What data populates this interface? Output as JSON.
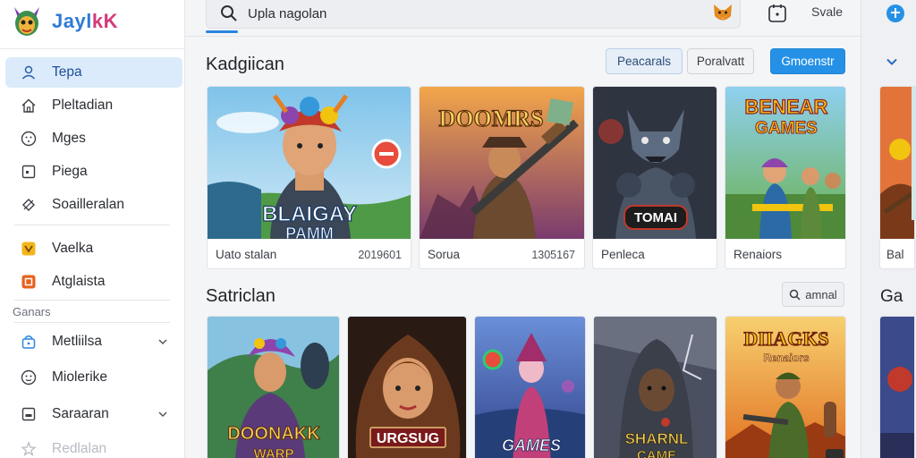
{
  "brand": {
    "name_main": "Jayl",
    "name_accent": "kK"
  },
  "search": {
    "value": "Upla nagolan",
    "placeholder": ""
  },
  "topbar": {
    "save_label": "Svale"
  },
  "sidebar": {
    "items": [
      {
        "label": "Tepa",
        "icon": "user-icon"
      },
      {
        "label": "Pleltadian",
        "icon": "home-icon"
      },
      {
        "label": "Mges",
        "icon": "smiley-icon"
      },
      {
        "label": "Piega",
        "icon": "page-icon"
      },
      {
        "label": "Soailleralan",
        "icon": "tag-icon"
      },
      {
        "label": "Vaelka",
        "icon": "orange-badge-icon"
      },
      {
        "label": "Atglaista",
        "icon": "orange-square-icon"
      }
    ],
    "section_label": "Ganars",
    "sub_items": [
      {
        "label": "Metliilsa",
        "icon": "lock-icon"
      },
      {
        "label": "Miolerike",
        "icon": "smiley-icon"
      },
      {
        "label": "Saraaran",
        "icon": "page-icon"
      },
      {
        "label": "Redlalan",
        "icon": "star-icon"
      }
    ]
  },
  "section1": {
    "title": "Kadgiican",
    "tabs": [
      "Peacarals",
      "Poralvatt",
      "Gmoenstr"
    ],
    "cards": [
      {
        "caption": "Uato stalan",
        "meta": "2019601",
        "art_text": "BLAIGAY",
        "art_text2": "PAMM"
      },
      {
        "caption": "Sorua",
        "meta": "1305167",
        "art_text": "DOOMRS"
      },
      {
        "caption": "Penleca",
        "meta": "",
        "art_text": "TOMAI"
      },
      {
        "caption": "Renaiors",
        "meta": "",
        "art_text": "BENEAR",
        "art_text2": "GAMES"
      }
    ],
    "overflow_caption": "Bal"
  },
  "section2": {
    "title": "Satriclan",
    "search_chip": "amnal",
    "cards": [
      {
        "art_text": "DOONAKK",
        "art_text2": "WARP"
      },
      {
        "art_text": "URGSUG"
      },
      {
        "art_text": "GAMES"
      },
      {
        "art_text": "SHARNL",
        "art_text2": "CAME"
      },
      {
        "art_text": "DIIAGKS",
        "art_text2": "Renaiors"
      }
    ],
    "overflow_label": "Ga"
  },
  "colors": {
    "accent": "#2591e6",
    "active_nav_bg": "#dcebfb",
    "orange": "#f29b1d"
  }
}
